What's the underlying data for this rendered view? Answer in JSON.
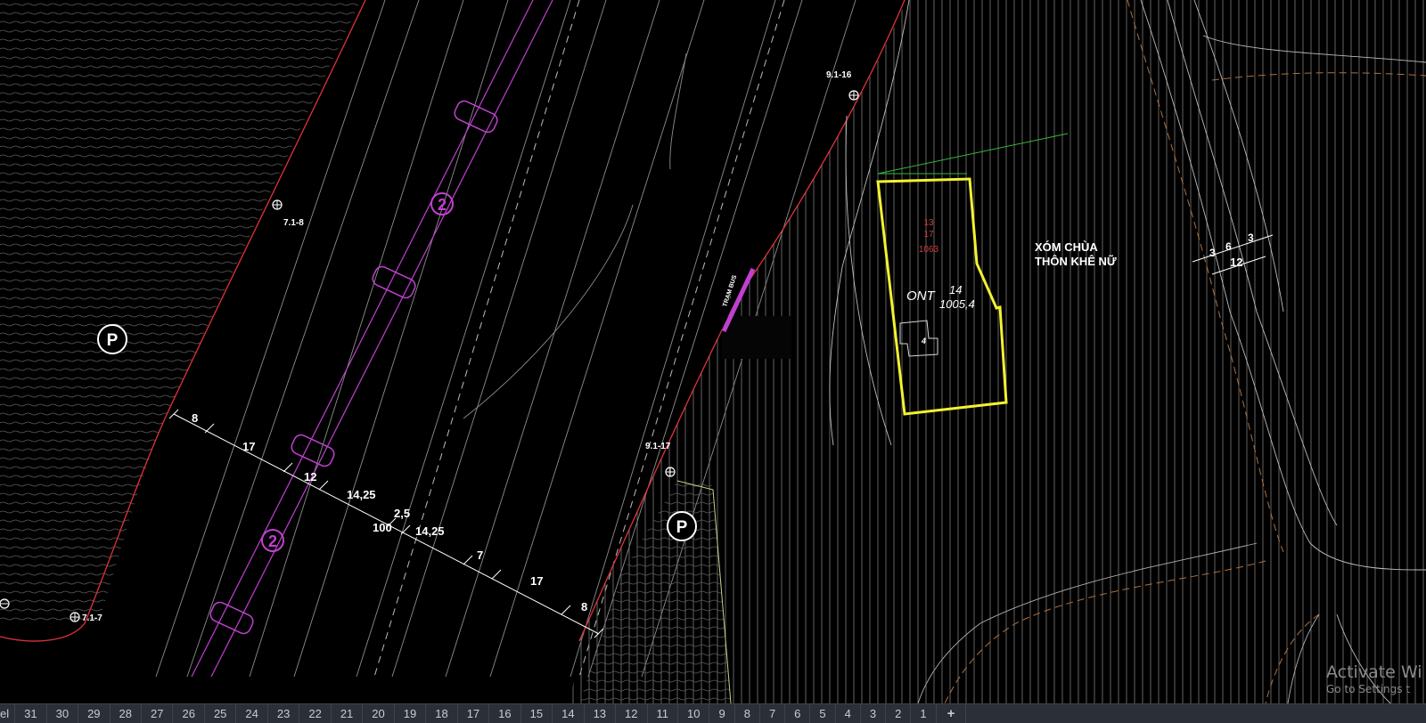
{
  "drawing": {
    "points": {
      "p1": "7.1-8",
      "p2": "7.1-7",
      "p3": "9.1-16",
      "p4": "9.1-17"
    },
    "parking": "P",
    "route": "2",
    "dimensions": {
      "d1": "8",
      "d2": "17",
      "d3": "12",
      "d4": "14,25",
      "d5": "2,5",
      "d6": "100",
      "d7": "14,25",
      "d8": "7",
      "d9": "17",
      "d10": "8"
    },
    "parcel": {
      "top_line_1": "13",
      "top_line_2": "17",
      "top_line_3": "1063",
      "code": "ONT",
      "number": "14",
      "area": "1005,4",
      "house_label": "4"
    },
    "place_label_1": "XÓM CHÙA",
    "place_label_2": "THÔN KHÊ NỮ",
    "right_dims": {
      "a": "3",
      "b": "6",
      "c": "3",
      "total": "12"
    },
    "small_label": "TRẠM BUS"
  },
  "watermark": {
    "title": "Activate Wi",
    "subtitle": "Go to Settings t"
  },
  "layout_tabs": {
    "first": "el",
    "numbers": [
      "31",
      "30",
      "29",
      "28",
      "27",
      "26",
      "25",
      "24",
      "23",
      "22",
      "21",
      "20",
      "19",
      "18",
      "17",
      "16",
      "15",
      "14",
      "13",
      "12",
      "11",
      "10",
      "9",
      "8",
      "7",
      "6",
      "5",
      "4",
      "3",
      "2",
      "1"
    ],
    "add": "+"
  },
  "colors": {
    "background": "#000000",
    "boundary": "#e0323a",
    "road_line": "#9a9a9a",
    "center_line": "#c040d0",
    "parcel_outline": "#f2f230",
    "dim_text": "#ffffff",
    "hatch": "#808080"
  }
}
